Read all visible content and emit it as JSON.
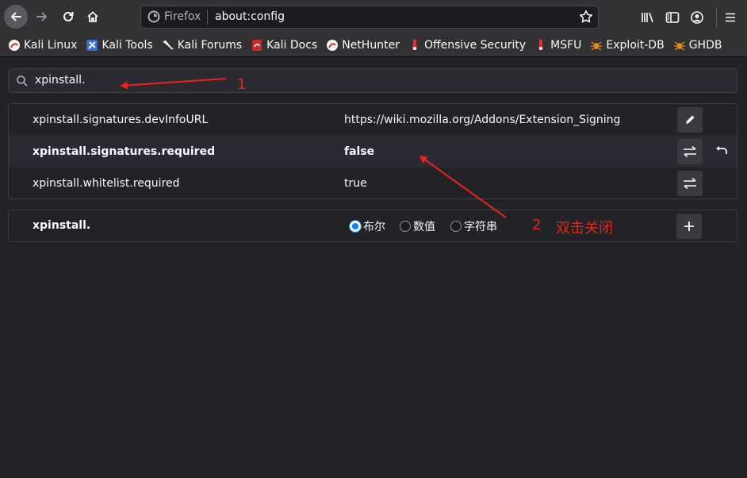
{
  "browser": {
    "identity_label": "Firefox",
    "url": "about:config"
  },
  "bookmarks": [
    {
      "label": "Kali Linux",
      "icon": "kali-dragon-icon"
    },
    {
      "label": "Kali Tools",
      "icon": "kali-tools-icon"
    },
    {
      "label": "Kali Forums",
      "icon": "kali-forums-icon"
    },
    {
      "label": "Kali Docs",
      "icon": "kali-docs-icon"
    },
    {
      "label": "NetHunter",
      "icon": "nethunter-icon"
    },
    {
      "label": "Offensive Security",
      "icon": "offsec-icon"
    },
    {
      "label": "MSFU",
      "icon": "msfu-icon"
    },
    {
      "label": "Exploit-DB",
      "icon": "exploitdb-icon"
    },
    {
      "label": "GHDB",
      "icon": "ghdb-icon"
    }
  ],
  "search": {
    "value": "xpinstall."
  },
  "prefs": [
    {
      "name": "xpinstall.signatures.devInfoURL",
      "value": "https://wiki.mozilla.org/Addons/Extension_Signing",
      "action": "edit",
      "modified": false
    },
    {
      "name": "xpinstall.signatures.required",
      "value": "false",
      "action": "toggle",
      "modified": true
    },
    {
      "name": "xpinstall.whitelist.required",
      "value": "true",
      "action": "toggle",
      "modified": false
    }
  ],
  "new_pref": {
    "name": "xpinstall.",
    "types": [
      {
        "label": "布尔",
        "selected": true
      },
      {
        "label": "数值",
        "selected": false
      },
      {
        "label": "字符串",
        "selected": false
      }
    ]
  },
  "annotations": {
    "step1": "1",
    "step2_number": "2",
    "step2_text": "双击关闭",
    "color": "#e8231c"
  }
}
